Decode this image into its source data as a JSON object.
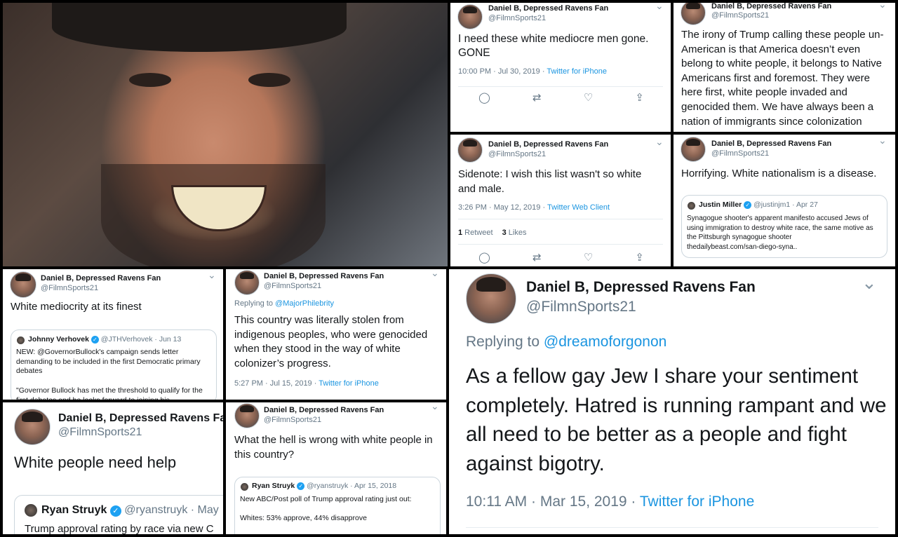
{
  "author": {
    "name": "Daniel B, Depressed Ravens Fan",
    "handle": "@FilmnSports21"
  },
  "tweets": {
    "t1": {
      "text": "I need these white mediocre men gone. GONE",
      "time": "10:00 PM · Jul 30, 2019 · ",
      "source": "Twitter for iPhone"
    },
    "t2": {
      "text": "The irony of Trump calling these people un-American is that America doesn’t even belong to white people, it belongs to Native Americans first and foremost. They were here first, white people invaded and genocided them. We have always been a nation of immigrants since colonization"
    },
    "t3": {
      "text": "Sidenote: I wish this list wasn't so white and male.",
      "time": "3:26 PM · May 12, 2019 · ",
      "source": "Twitter Web Client",
      "retweets_count": "1",
      "retweets_label": " Retweet",
      "likes_count": "3",
      "likes_label": " Likes"
    },
    "t4": {
      "text": "Horrifying. White nationalism is a disease.",
      "quote": {
        "name": "Justin Miller",
        "meta": "@justinjm1 · Apr 27",
        "text": "Synagogue shooter's apparent manifesto accused Jews of using immigration to destroy white race, the same motive as the Pittsburgh synagogue shooter",
        "link": "thedailybeast.com/san-diego-syna.."
      }
    },
    "t5": {
      "text": "White mediocrity at its finest",
      "quote": {
        "name": "Johnny Verhovek",
        "meta": "@JTHVerhovek · Jun 13",
        "text": "NEW: @GovernorBullock's campaign sends letter demanding to be included in the first Democratic primary debates",
        "text2": "\"Governor Bullock has met the threshold to qualify for the first debates and he looks forward to joining his"
      }
    },
    "t6": {
      "replying_prefix": "Replying to ",
      "replying_to": "@MajorPhilebrity",
      "text": "This country was literally stolen from indigenous peoples, who were genocided when they stood in the way of white colonizer’s progress.",
      "time": "5:27 PM · Jul 15, 2019 · ",
      "source": "Twitter for iPhone"
    },
    "t7": {
      "text": "White people need help",
      "quote": {
        "name": "Ryan Struyk",
        "meta": "@ryanstruyk · May",
        "text": "Trump approval rating by race via new C"
      }
    },
    "t8": {
      "text": "What the hell is wrong with white people in this country?",
      "quote": {
        "name": "Ryan Struyk",
        "meta": "@ryanstruyk · Apr 15, 2018",
        "text": "New ABC/Post poll of Trump approval rating just out:",
        "text2": "Whites: 53% approve, 44% disapprove"
      }
    },
    "t9": {
      "replying_prefix": "Replying to ",
      "replying_to": "@dreamoforgonon",
      "text": "As a fellow gay Jew I share your sentiment completely. Hatred is running rampant and we all need to be better as a people and fight against bigotry.",
      "time": "10:11 AM · Mar 15, 2019 · ",
      "source": "Twitter for iPhone"
    }
  },
  "icons": {
    "chevron": "⌄",
    "reply": "◯",
    "retweet": "⇄",
    "like": "♡",
    "share": "⇪",
    "verified": "✓"
  },
  "colors": {
    "link": "#1b95e0",
    "muted": "#657786",
    "verified": "#1da1f2"
  }
}
